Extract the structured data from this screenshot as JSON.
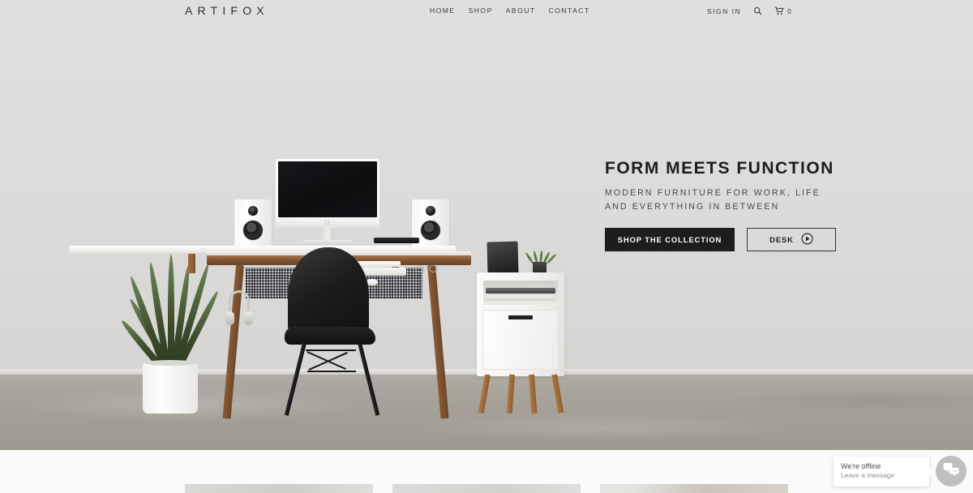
{
  "site": {
    "logo": "ARTIFOX"
  },
  "nav": {
    "items": [
      {
        "label": "HOME",
        "name": "nav-home"
      },
      {
        "label": "SHOP",
        "name": "nav-shop"
      },
      {
        "label": "ABOUT",
        "name": "nav-about"
      },
      {
        "label": "CONTACT",
        "name": "nav-contact"
      }
    ]
  },
  "header_right": {
    "sign_in": "SIGN IN",
    "search_icon": "search-icon",
    "cart_icon": "shopping-cart-icon",
    "cart_count": "0"
  },
  "hero": {
    "headline": "FORM MEETS FUNCTION",
    "subline_1": "MODERN FURNITURE FOR WORK, LIFE",
    "subline_2": "AND EVERYTHING IN BETWEEN",
    "primary_cta": "SHOP THE COLLECTION",
    "secondary_cta": "DESK",
    "secondary_cta_icon": "play-circle-icon",
    "scene_alt": "workspace-photo"
  },
  "chat": {
    "title": "We're offline",
    "subtitle": "Leave a message",
    "icon": "chat-bubbles-icon"
  },
  "colors": {
    "wall": "#dcdbda",
    "floor": "#a7a29a",
    "text_dark": "#1d1d1d",
    "button_solid_bg": "#1d1d1d",
    "button_solid_text": "#ffffff",
    "page_bg": "#fafafa",
    "chat_circle": "#bfbfbf"
  }
}
